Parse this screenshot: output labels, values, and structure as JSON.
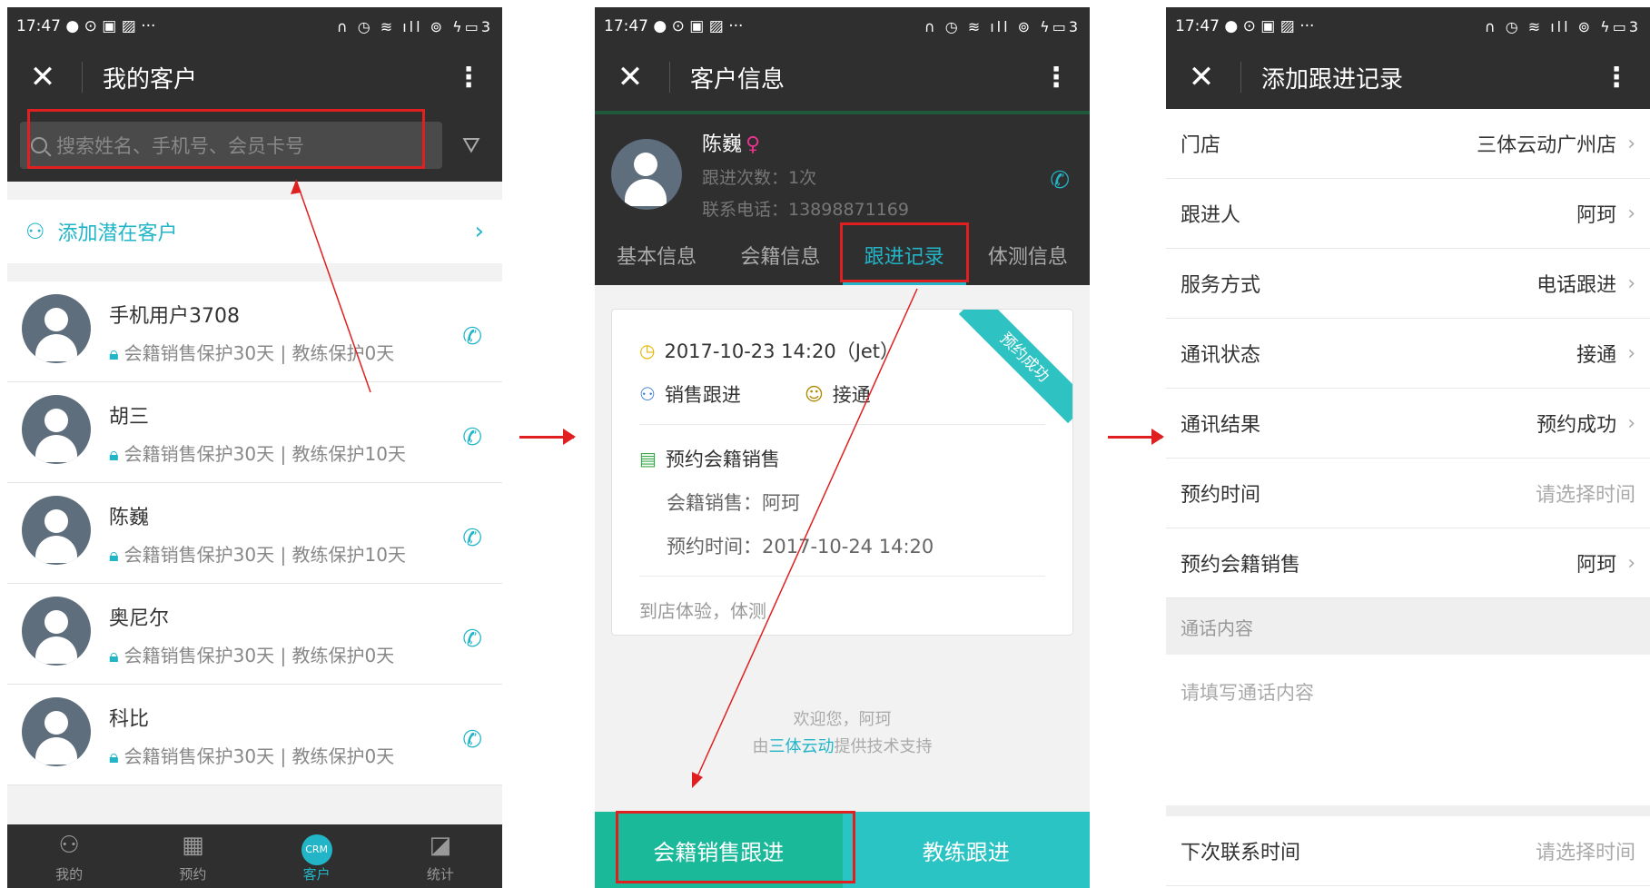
{
  "status": {
    "time": "17:47",
    "left_icons": "● ⊙ ▣ ▨ ···",
    "right_icons": "∩ ◷ ≋ ıll ⊚ ϟ▭3"
  },
  "panel1": {
    "title": "我的客户",
    "search_placeholder": "搜索姓名、手机号、会员卡号",
    "filter_icon": "filter-icon",
    "add_label": "添加潜在客户",
    "customers": [
      {
        "name": "手机用户3708",
        "detail": "会籍销售保护30天 | 教练保护0天"
      },
      {
        "name": "胡三",
        "detail": "会籍销售保护30天 | 教练保护10天"
      },
      {
        "name": "陈巍",
        "detail": "会籍销售保护30天 | 教练保护10天"
      },
      {
        "name": "奥尼尔",
        "detail": "会籍销售保护30天 | 教练保护0天"
      },
      {
        "name": "科比",
        "detail": "会籍销售保护30天 | 教练保护0天"
      }
    ],
    "tabs": [
      {
        "label": "我的",
        "icon": "person-icon"
      },
      {
        "label": "预约",
        "icon": "calendar-icon"
      },
      {
        "label": "客户",
        "icon": "crm-icon",
        "badge": "CRM"
      },
      {
        "label": "统计",
        "icon": "chart-icon"
      }
    ]
  },
  "panel2": {
    "title": "客户信息",
    "name": "陈巍",
    "visits": "跟进次数：1次",
    "phone": "联系电话：13898871169",
    "tabs": [
      "基本信息",
      "会籍信息",
      "跟进记录",
      "体测信息"
    ],
    "record": {
      "ribbon": "预约成功",
      "datetime": "2017-10-23 14:20（Jet）",
      "type": "销售跟进",
      "status": "接通",
      "appointment": "预约会籍销售",
      "sales": "会籍销售：阿珂",
      "appt_time": "预约时间：2017-10-24 14:20",
      "note": "到店体验，体测"
    },
    "welcome": "欢迎您，阿珂",
    "support_prefix": "由",
    "support_link": "三体云动",
    "support_suffix": "提供技术支持",
    "btn_left": "会籍销售跟进",
    "btn_right": "教练跟进"
  },
  "panel3": {
    "title": "添加跟进记录",
    "fields": [
      {
        "label": "门店",
        "value": "三体云动广州店",
        "arrow": true
      },
      {
        "label": "跟进人",
        "value": "阿珂",
        "arrow": true
      },
      {
        "label": "服务方式",
        "value": "电话跟进",
        "arrow": true
      },
      {
        "label": "通讯状态",
        "value": "接通",
        "arrow": true
      },
      {
        "label": "通讯结果",
        "value": "预约成功",
        "arrow": true
      },
      {
        "label": "预约时间",
        "placeholder": "请选择时间"
      },
      {
        "label": "预约会籍销售",
        "value": "阿珂",
        "arrow": true
      }
    ],
    "section_label": "通话内容",
    "content_placeholder": "请填写通话内容",
    "next_label": "下次联系时间",
    "next_placeholder": "请选择时间"
  }
}
